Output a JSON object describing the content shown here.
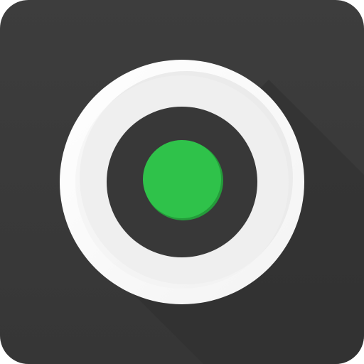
{
  "app_icon": {
    "name": "camera-shutter-app-icon",
    "colors": {
      "tile_background": "#3a3a3a",
      "tile_edge": "#2c2c2c",
      "long_shadow": "#2f2f2f",
      "ring_outer": "#ffffff",
      "ring_inner_shade": "#e6e6e6",
      "lens_dark": "#383838",
      "record_dot": "#2fc24a",
      "record_dot_shadow": "#1f9a36"
    },
    "elements": {
      "outer_ring_icon": "white-ring-icon",
      "lens_icon": "dark-lens-icon",
      "record_indicator_icon": "green-record-dot-icon"
    }
  }
}
